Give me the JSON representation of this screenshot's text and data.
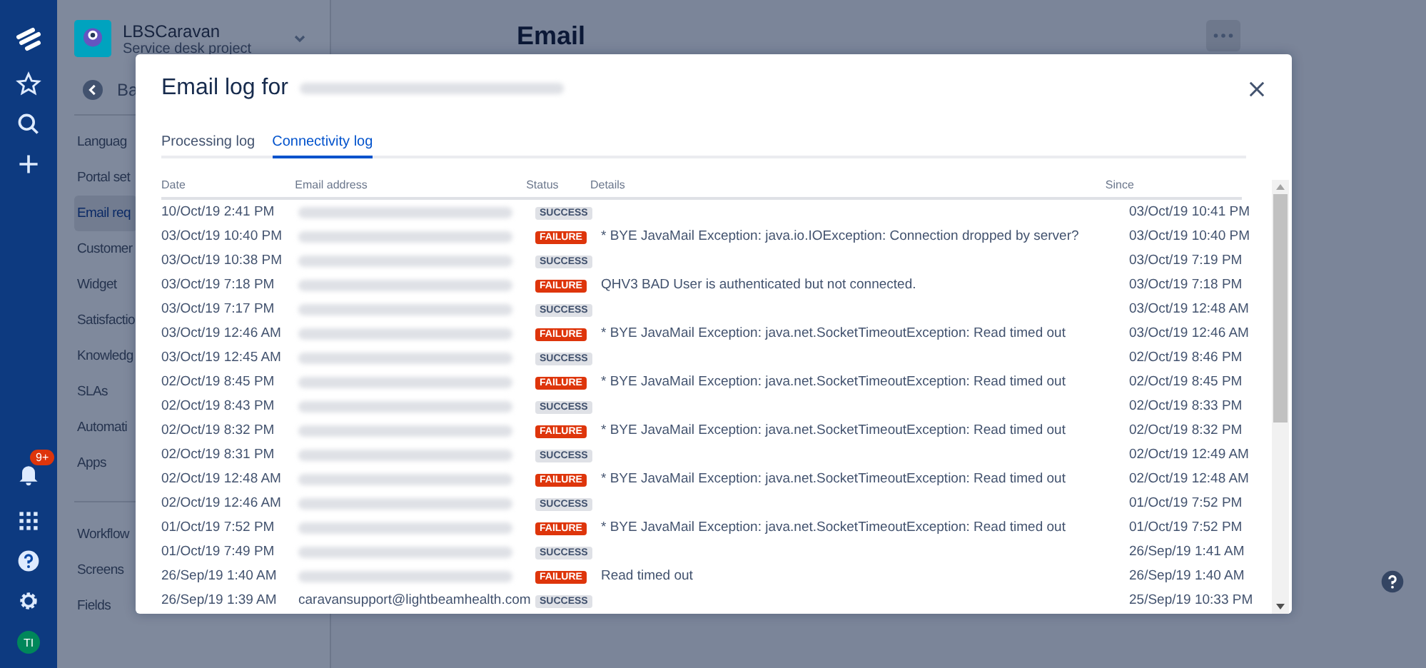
{
  "nav": {
    "notification_badge": "9+",
    "avatar": "TI"
  },
  "project": {
    "name": "LBSCaravan",
    "type": "Service desk project",
    "back": "Ba",
    "items": [
      {
        "label": "Languag",
        "selected": false
      },
      {
        "label": "Portal set",
        "selected": false
      },
      {
        "label": "Email req",
        "selected": true
      },
      {
        "label": "Customer",
        "selected": false
      },
      {
        "label": "Widget",
        "selected": false
      },
      {
        "label": "Satisfactio",
        "selected": false
      },
      {
        "label": "Knowledg",
        "selected": false
      },
      {
        "label": "SLAs",
        "selected": false
      },
      {
        "label": "Automati",
        "selected": false
      },
      {
        "label": "Apps",
        "selected": false
      }
    ],
    "items_2": [
      {
        "label": "Workflow",
        "selected": false
      },
      {
        "label": "Screens",
        "selected": false
      },
      {
        "label": "Fields",
        "selected": false
      }
    ]
  },
  "page": {
    "title": "Email"
  },
  "dialog": {
    "title": "Email log for",
    "tabs": [
      {
        "label": "Processing log",
        "selected": false
      },
      {
        "label": "Connectivity log",
        "selected": true
      }
    ],
    "table": {
      "columns": [
        "Date",
        "Email address",
        "Status",
        "Details",
        "Since"
      ],
      "rows": [
        {
          "date": "10/Oct/19 2:41 PM",
          "status": {
            "kind": "success",
            "label": "SUCCESS"
          },
          "details": "",
          "since": "03/Oct/19 10:41 PM"
        },
        {
          "date": "03/Oct/19 10:40 PM",
          "status": {
            "kind": "failure",
            "label": "FAILURE"
          },
          "details": "* BYE JavaMail Exception: java.io.IOException: Connection dropped by server?",
          "since": "03/Oct/19 10:40 PM"
        },
        {
          "date": "03/Oct/19 10:38 PM",
          "status": {
            "kind": "success",
            "label": "SUCCESS"
          },
          "details": "",
          "since": "03/Oct/19 7:19 PM"
        },
        {
          "date": "03/Oct/19 7:18 PM",
          "status": {
            "kind": "failure",
            "label": "FAILURE"
          },
          "details": "QHV3 BAD User is authenticated but not connected.",
          "since": "03/Oct/19 7:18 PM"
        },
        {
          "date": "03/Oct/19 7:17 PM",
          "status": {
            "kind": "success",
            "label": "SUCCESS"
          },
          "details": "",
          "since": "03/Oct/19 12:48 AM"
        },
        {
          "date": "03/Oct/19 12:46 AM",
          "status": {
            "kind": "failure",
            "label": "FAILURE"
          },
          "details": "* BYE JavaMail Exception: java.net.SocketTimeoutException: Read timed out",
          "since": "03/Oct/19 12:46 AM"
        },
        {
          "date": "03/Oct/19 12:45 AM",
          "status": {
            "kind": "success",
            "label": "SUCCESS"
          },
          "details": "",
          "since": "02/Oct/19 8:46 PM"
        },
        {
          "date": "02/Oct/19 8:45 PM",
          "status": {
            "kind": "failure",
            "label": "FAILURE"
          },
          "details": "* BYE JavaMail Exception: java.net.SocketTimeoutException: Read timed out",
          "since": "02/Oct/19 8:45 PM"
        },
        {
          "date": "02/Oct/19 8:43 PM",
          "status": {
            "kind": "success",
            "label": "SUCCESS"
          },
          "details": "",
          "since": "02/Oct/19 8:33 PM"
        },
        {
          "date": "02/Oct/19 8:32 PM",
          "status": {
            "kind": "failure",
            "label": "FAILURE"
          },
          "details": "* BYE JavaMail Exception: java.net.SocketTimeoutException: Read timed out",
          "since": "02/Oct/19 8:32 PM"
        },
        {
          "date": "02/Oct/19 8:31 PM",
          "status": {
            "kind": "success",
            "label": "SUCCESS"
          },
          "details": "",
          "since": "02/Oct/19 12:49 AM"
        },
        {
          "date": "02/Oct/19 12:48 AM",
          "status": {
            "kind": "failure",
            "label": "FAILURE"
          },
          "details": "* BYE JavaMail Exception: java.net.SocketTimeoutException: Read timed out",
          "since": "02/Oct/19 12:48 AM"
        },
        {
          "date": "02/Oct/19 12:46 AM",
          "status": {
            "kind": "success",
            "label": "SUCCESS"
          },
          "details": "",
          "since": "01/Oct/19 7:52 PM"
        },
        {
          "date": "01/Oct/19 7:52 PM",
          "status": {
            "kind": "failure",
            "label": "FAILURE"
          },
          "details": "* BYE JavaMail Exception: java.net.SocketTimeoutException: Read timed out",
          "since": "01/Oct/19 7:52 PM"
        },
        {
          "date": "01/Oct/19 7:49 PM",
          "status": {
            "kind": "success",
            "label": "SUCCESS"
          },
          "details": "",
          "since": "26/Sep/19 1:41 AM"
        },
        {
          "date": "26/Sep/19 1:40 AM",
          "status": {
            "kind": "failure",
            "label": "FAILURE"
          },
          "details": "Read timed out",
          "since": "26/Sep/19 1:40 AM"
        },
        {
          "date": "26/Sep/19 1:39 AM",
          "email": "caravansupport@lightbeamhealth.com",
          "status": {
            "kind": "success",
            "label": "SUCCESS"
          },
          "details": "",
          "since": "25/Sep/19 10:33 PM"
        }
      ]
    }
  }
}
